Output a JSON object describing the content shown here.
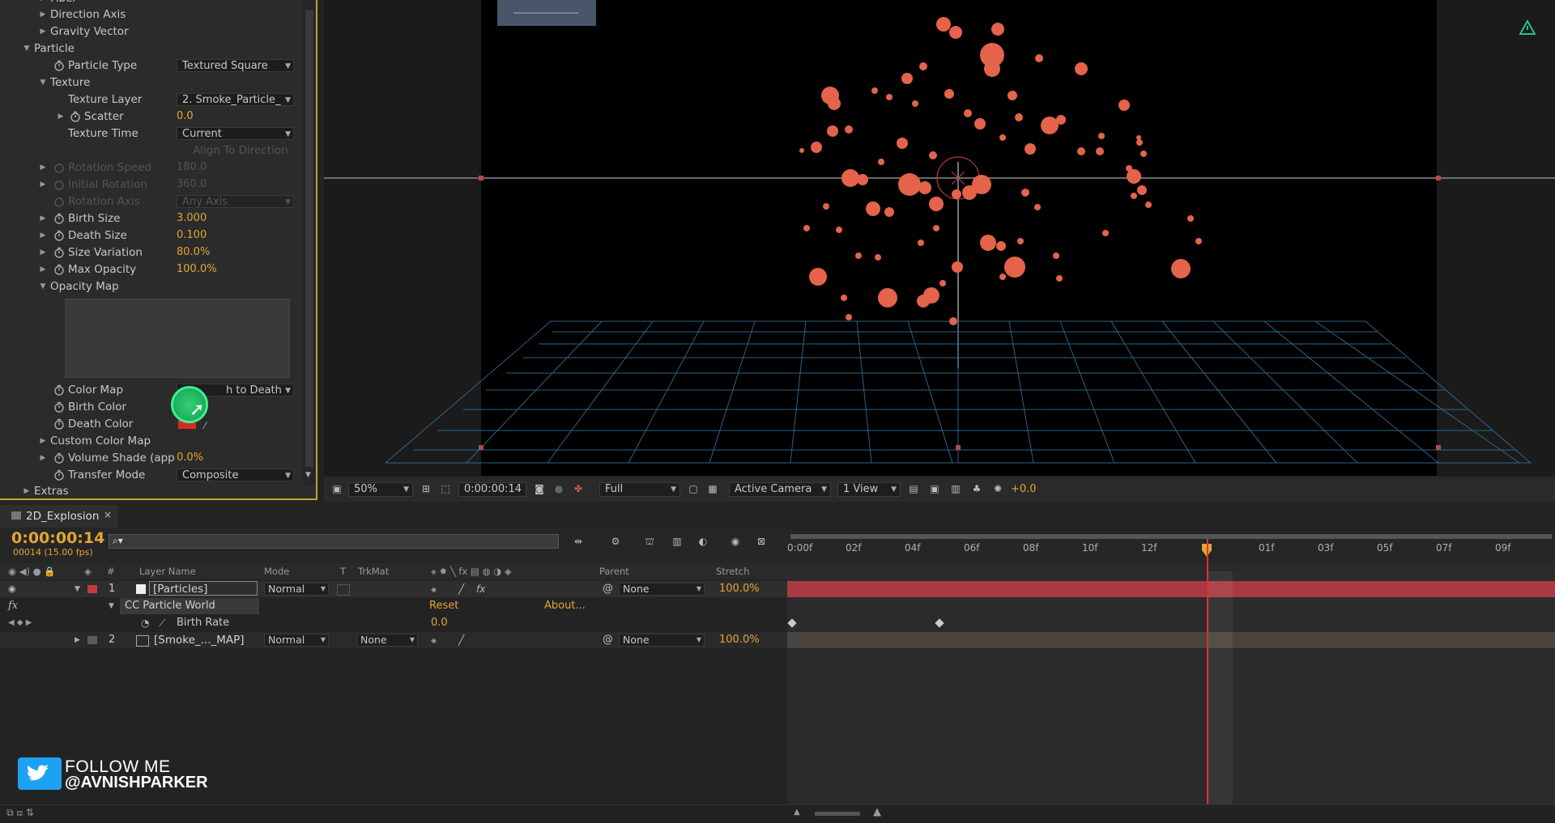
{
  "effect_controls": {
    "top_partial": "Fiber",
    "rows": [
      {
        "label": "Direction Axis",
        "twirl": "right"
      },
      {
        "label": "Gravity Vector",
        "twirl": "right"
      },
      {
        "label": "Particle",
        "twirl": "down"
      },
      {
        "label": "Particle Type",
        "dropdown": "Textured Square"
      },
      {
        "label": "Texture",
        "twirl": "down"
      },
      {
        "label": "Texture Layer",
        "dropdown": "2. Smoke_Particle_"
      },
      {
        "label": "Scatter",
        "value": "0.0"
      },
      {
        "label": "Texture Time",
        "dropdown": "Current"
      },
      {
        "label": "Align To Direction"
      },
      {
        "label": "Rotation Speed",
        "value": "180.0"
      },
      {
        "label": "Initial Rotation",
        "value": "360.0"
      },
      {
        "label": "Rotation Axis",
        "dropdown": "Any Axis"
      },
      {
        "label": "Birth Size",
        "value": "3.000"
      },
      {
        "label": "Death Size",
        "value": "0.100"
      },
      {
        "label": "Size Variation",
        "value": "80.0%"
      },
      {
        "label": "Max Opacity",
        "value": "100.0%"
      },
      {
        "label": "Opacity Map",
        "twirl": "down"
      },
      {
        "label": "Color Map",
        "dropdown": "h to Death"
      },
      {
        "label": "Birth Color"
      },
      {
        "label": "Death Color"
      },
      {
        "label": "Custom Color Map"
      },
      {
        "label": "Volume Shade (app",
        "value": "0.0%"
      },
      {
        "label": "Transfer Mode",
        "dropdown": "Composite"
      },
      {
        "label": "Extras"
      }
    ],
    "colors": {
      "birth_color": "#e8e8e8",
      "death_color": "#d62a2a"
    }
  },
  "viewer_toolbar": {
    "zoom": "50%",
    "timecode": "0:00:00:14",
    "resolution": "Full",
    "camera": "Active Camera",
    "views": "1 View",
    "exposure": "+0.0"
  },
  "timeline": {
    "comp_tab": "2D_Explosion",
    "current_time": "0:00:00:14",
    "frame_info": "00014 (15.00 fps)",
    "search_placeholder": "",
    "columns": {
      "num": "#",
      "layer_name": "Layer Name",
      "mode": "Mode",
      "t": "T",
      "trkmat": "TrkMat",
      "parent": "Parent",
      "stretch": "Stretch"
    },
    "layers": [
      {
        "num": "1",
        "name": "[Particles]",
        "mode": "Normal",
        "trkmat": "",
        "parent": "None",
        "stretch": "100.0%",
        "label_color": "#c23c3c"
      },
      {
        "num": "2",
        "name": "[Smoke_..._MAP]",
        "mode": "Normal",
        "trkmat": "None",
        "parent": "None",
        "stretch": "100.0%",
        "label_color": "#5a5a5a"
      }
    ],
    "effect": {
      "name": "CC Particle World",
      "reset": "Reset",
      "about": "About..."
    },
    "property": {
      "name": "Birth Rate",
      "value": "0.0"
    },
    "ruler_ticks": [
      "0:00f",
      "02f",
      "04f",
      "06f",
      "08f",
      "10f",
      "12f",
      "01f",
      "03f",
      "05f",
      "07f",
      "09f"
    ]
  },
  "overlay": {
    "follow": "FOLLOW ME",
    "handle": "@AVNISHPARKER"
  }
}
